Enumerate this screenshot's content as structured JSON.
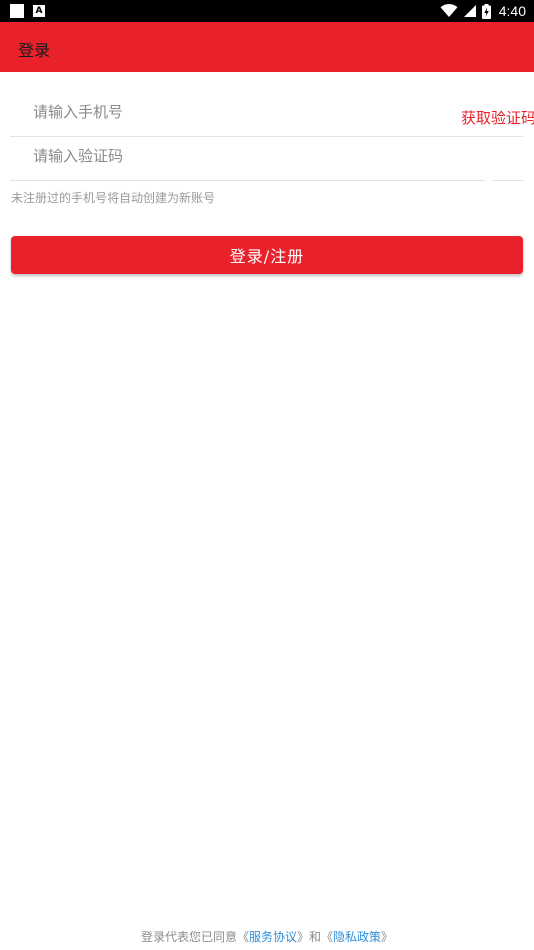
{
  "status_bar": {
    "time": "4:40",
    "left_icons": [
      "square-icon",
      "a-notification-icon"
    ],
    "right_icons": [
      "wifi-icon",
      "signal-icon",
      "battery-icon"
    ]
  },
  "app_bar": {
    "title": "登录",
    "background": "#E8212B"
  },
  "form": {
    "phone_placeholder": "请输入手机号",
    "code_placeholder": "请输入验证码",
    "get_code_label": "获取验证码",
    "hint": "未注册过的手机号将自动创建为新账号",
    "submit_label": "登录/注册"
  },
  "footer": {
    "prefix": "登录代表您已同意《",
    "terms_link": "服务协议",
    "middle": "》和《",
    "privacy_link": "隐私政策",
    "suffix": "》",
    "link_color": "#2e8fdc"
  }
}
